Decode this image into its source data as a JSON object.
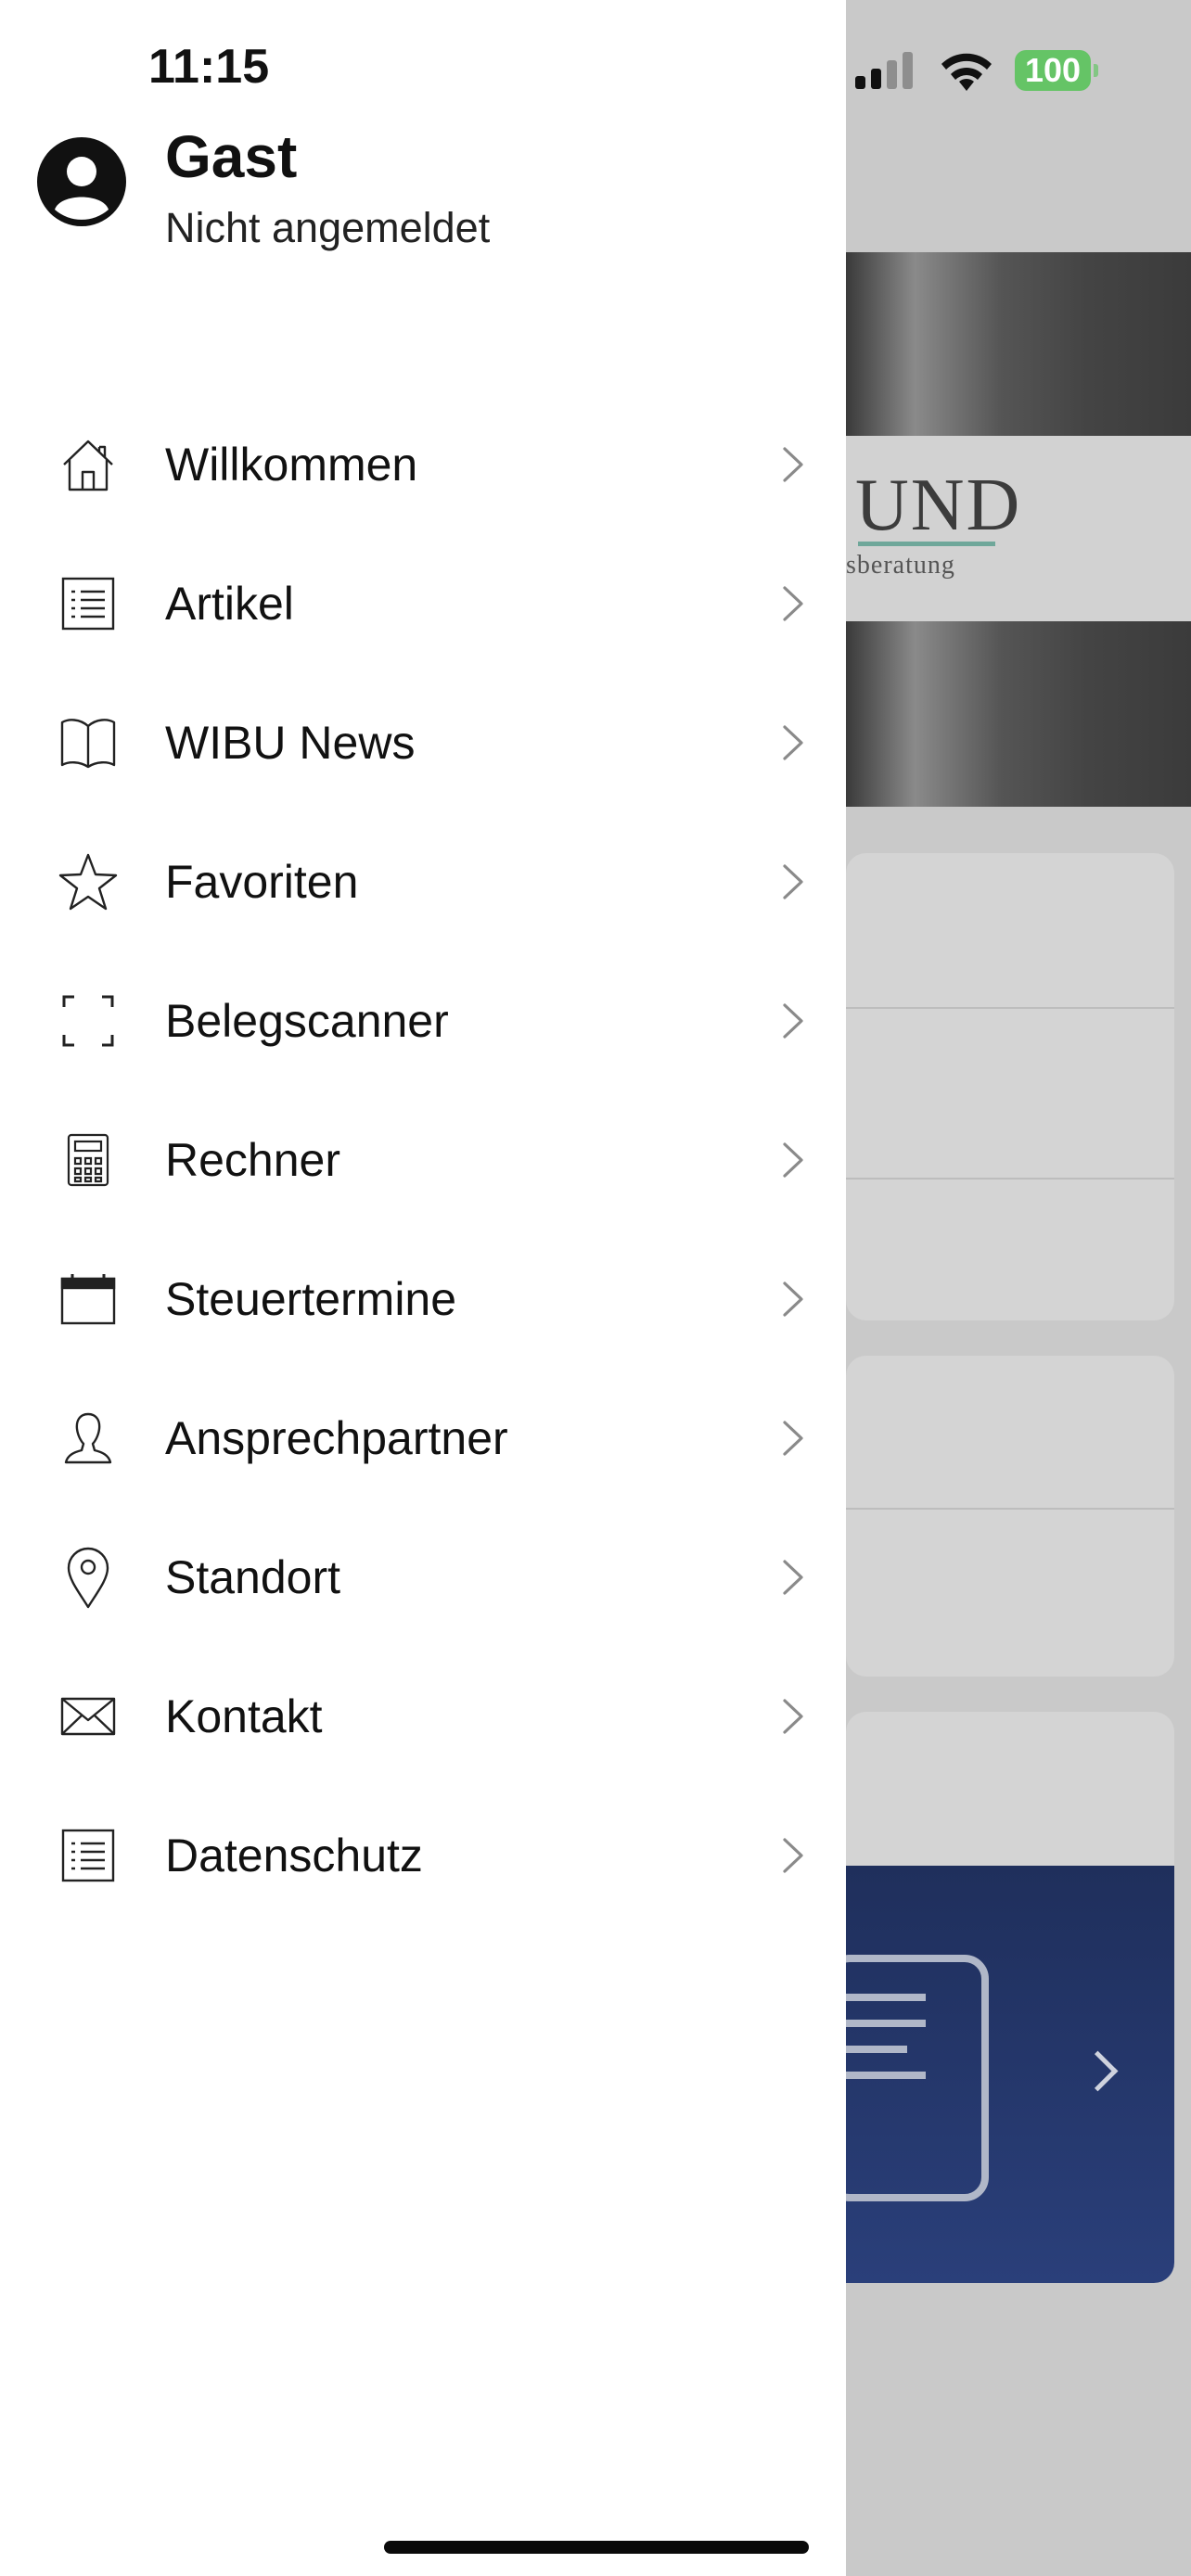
{
  "status_bar": {
    "time": "11:15",
    "battery": "100"
  },
  "user": {
    "name": "Gast",
    "status": "Nicht angemeldet"
  },
  "menu": [
    {
      "label": "Willkommen",
      "icon": "home-icon"
    },
    {
      "label": "Artikel",
      "icon": "list-icon"
    },
    {
      "label": "WIBU News",
      "icon": "book-icon"
    },
    {
      "label": "Favoriten",
      "icon": "star-icon"
    },
    {
      "label": "Belegscanner",
      "icon": "scan-frame-icon"
    },
    {
      "label": "Rechner",
      "icon": "calculator-icon"
    },
    {
      "label": "Steuertermine",
      "icon": "calendar-icon"
    },
    {
      "label": "Ansprechpartner",
      "icon": "person-icon"
    },
    {
      "label": "Standort",
      "icon": "location-pin-icon"
    },
    {
      "label": "Kontakt",
      "icon": "envelope-icon"
    },
    {
      "label": "Datenschutz",
      "icon": "list-icon"
    }
  ],
  "background_app": {
    "logo_text": "UND",
    "logo_subtext": "sberatung"
  },
  "colors": {
    "drawer_bg": "#ffffff",
    "battery": "#65c466",
    "banner_blue": "#26386c",
    "logo_accent": "#6fa79a"
  }
}
